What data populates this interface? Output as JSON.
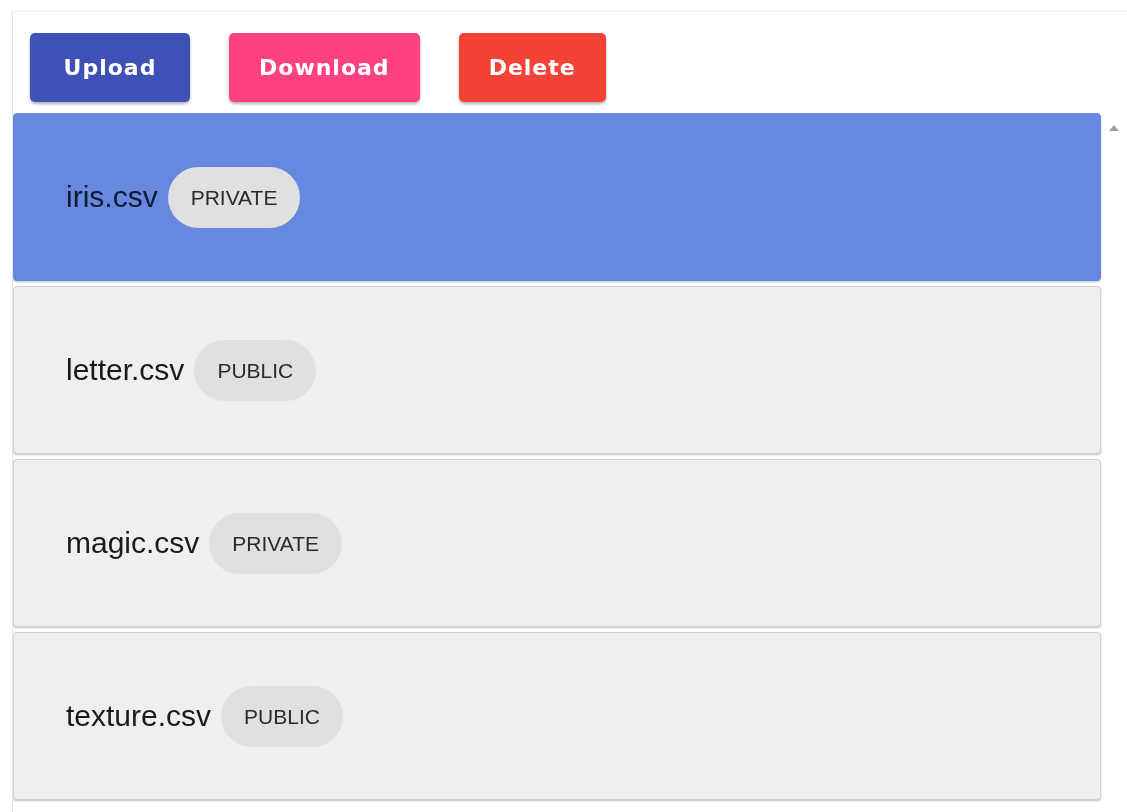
{
  "toolbar": {
    "buttons": [
      {
        "label": "Upload",
        "color": "#3f51b5"
      },
      {
        "label": "Download",
        "color": "#ff4081"
      },
      {
        "label": "Delete",
        "color": "#f44336"
      }
    ]
  },
  "files": [
    {
      "name": "iris.csv",
      "tag": "PRIVATE",
      "selected": true
    },
    {
      "name": "letter.csv",
      "tag": "PUBLIC",
      "selected": false
    },
    {
      "name": "magic.csv",
      "tag": "PRIVATE",
      "selected": false
    },
    {
      "name": "texture.csv",
      "tag": "PUBLIC",
      "selected": false
    }
  ]
}
